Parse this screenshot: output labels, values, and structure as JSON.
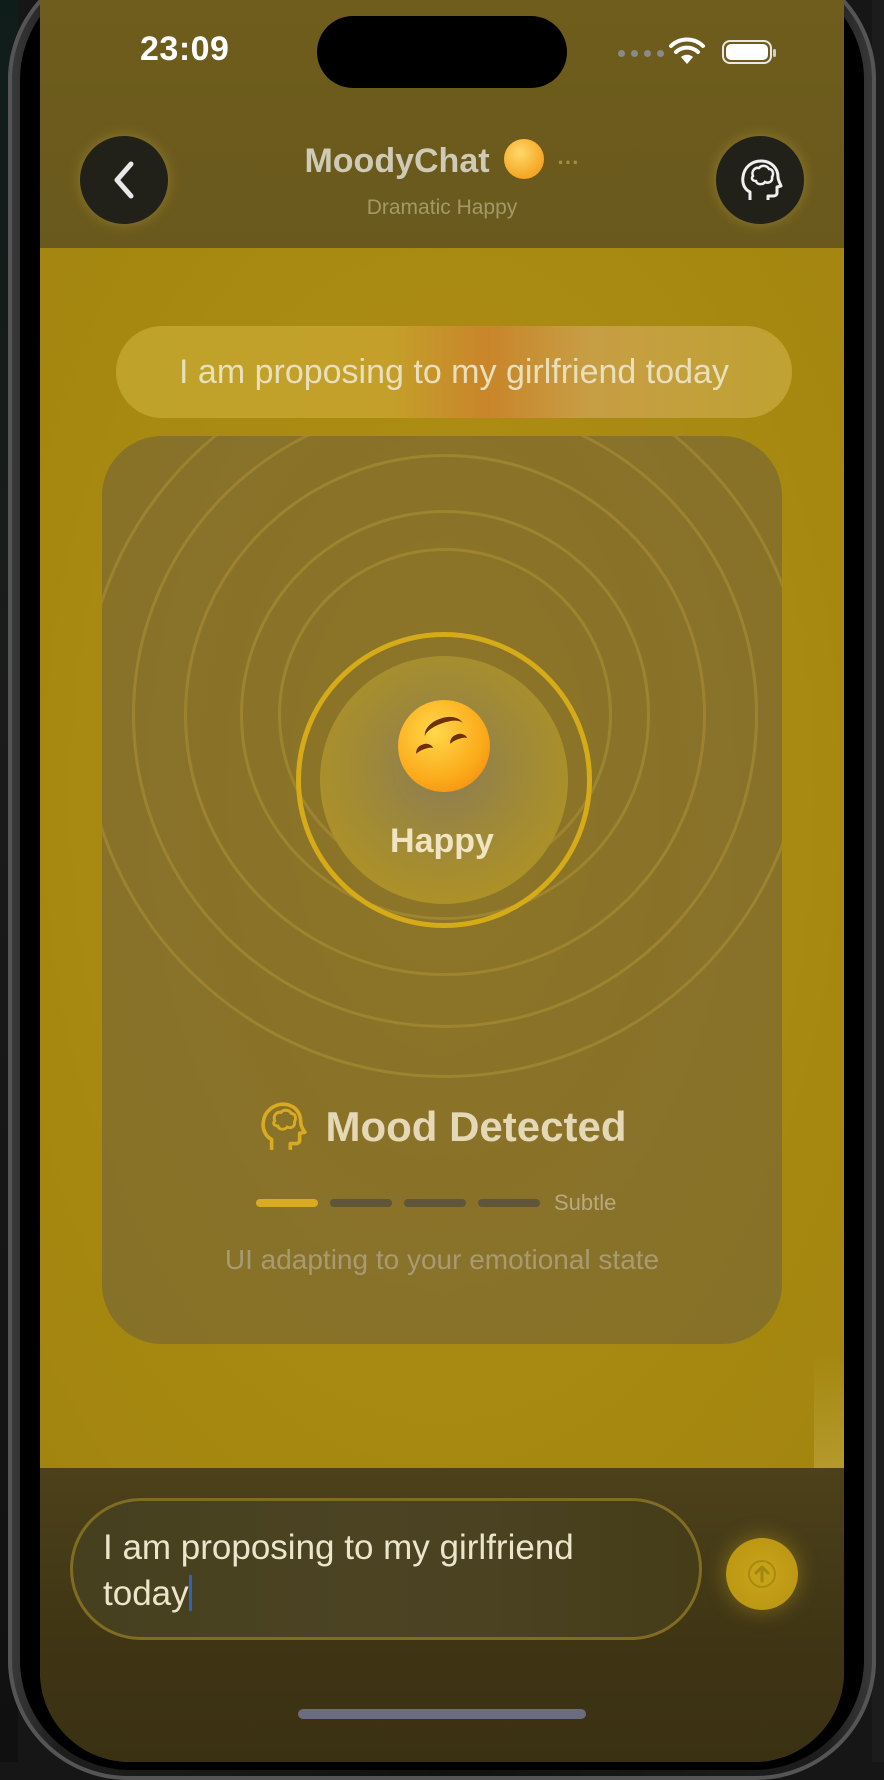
{
  "status_bar": {
    "time": "23:09"
  },
  "header": {
    "title": "MoodyChat",
    "subtitle": "Dramatic Happy",
    "title_emoji": "smiling-face-icon"
  },
  "message": {
    "text": "I am proposing to my girlfriend today"
  },
  "mood_card": {
    "mood": "Happy",
    "detected_title": "Mood Detected",
    "intensity_label": "Subtle",
    "intensity_level": 1,
    "intensity_max": 4,
    "adapting_text": "UI adapting to your emotional state",
    "accent": "#d8ab22"
  },
  "composer": {
    "value_line1": "I am proposing to my girlfriend",
    "value_line2": "today"
  },
  "colors": {
    "header_bg": "#6b5a1c",
    "chat_bg": "#a9890f",
    "accent": "#d8ab22"
  }
}
